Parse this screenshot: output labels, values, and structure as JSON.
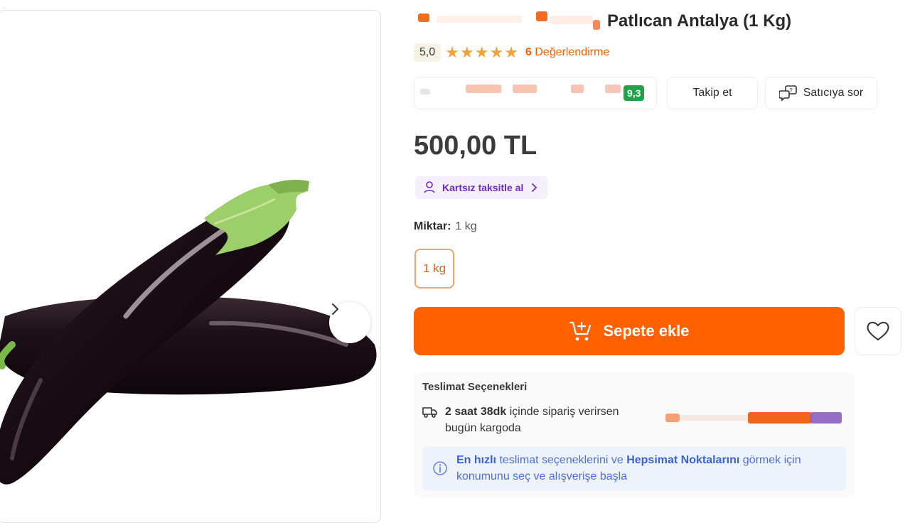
{
  "product": {
    "title": "Patlıcan Antalya (1 Kg)",
    "image_alt": "eggplant-product-image"
  },
  "rating": {
    "score": "5,0",
    "stars": 5,
    "review_count": "6",
    "review_label": "Değerlendirme"
  },
  "seller": {
    "score": "9,3",
    "follow_label": "Takip et",
    "ask_label": "Satıcıya sor"
  },
  "price": {
    "text": "500,00 TL"
  },
  "installment": {
    "label": "Kartsız taksitle al"
  },
  "quantity": {
    "label": "Miktar:",
    "value": "1 kg",
    "option": "1 kg"
  },
  "cart": {
    "add_label": "Sepete ekle"
  },
  "delivery": {
    "title": "Teslimat Seçenekleri",
    "time_strong": "2 saat 38dk",
    "time_rest": " içinde sipariş verirsen",
    "line2": "bugün kargoda",
    "note_part1": "En hızlı",
    "note_part2": " teslimat seçeneklerini ve ",
    "note_part3": "Hepsimat Noktalarını",
    "note_part4": " görmek için",
    "note_line2": "konumunu seç ve alışverişe başla"
  },
  "colors": {
    "accent": "#ff6000",
    "star": "#f1a33a",
    "installment_text": "#6a2cbf",
    "seller_score_bg": "#21a14a",
    "info_text": "#4e6fd4"
  }
}
